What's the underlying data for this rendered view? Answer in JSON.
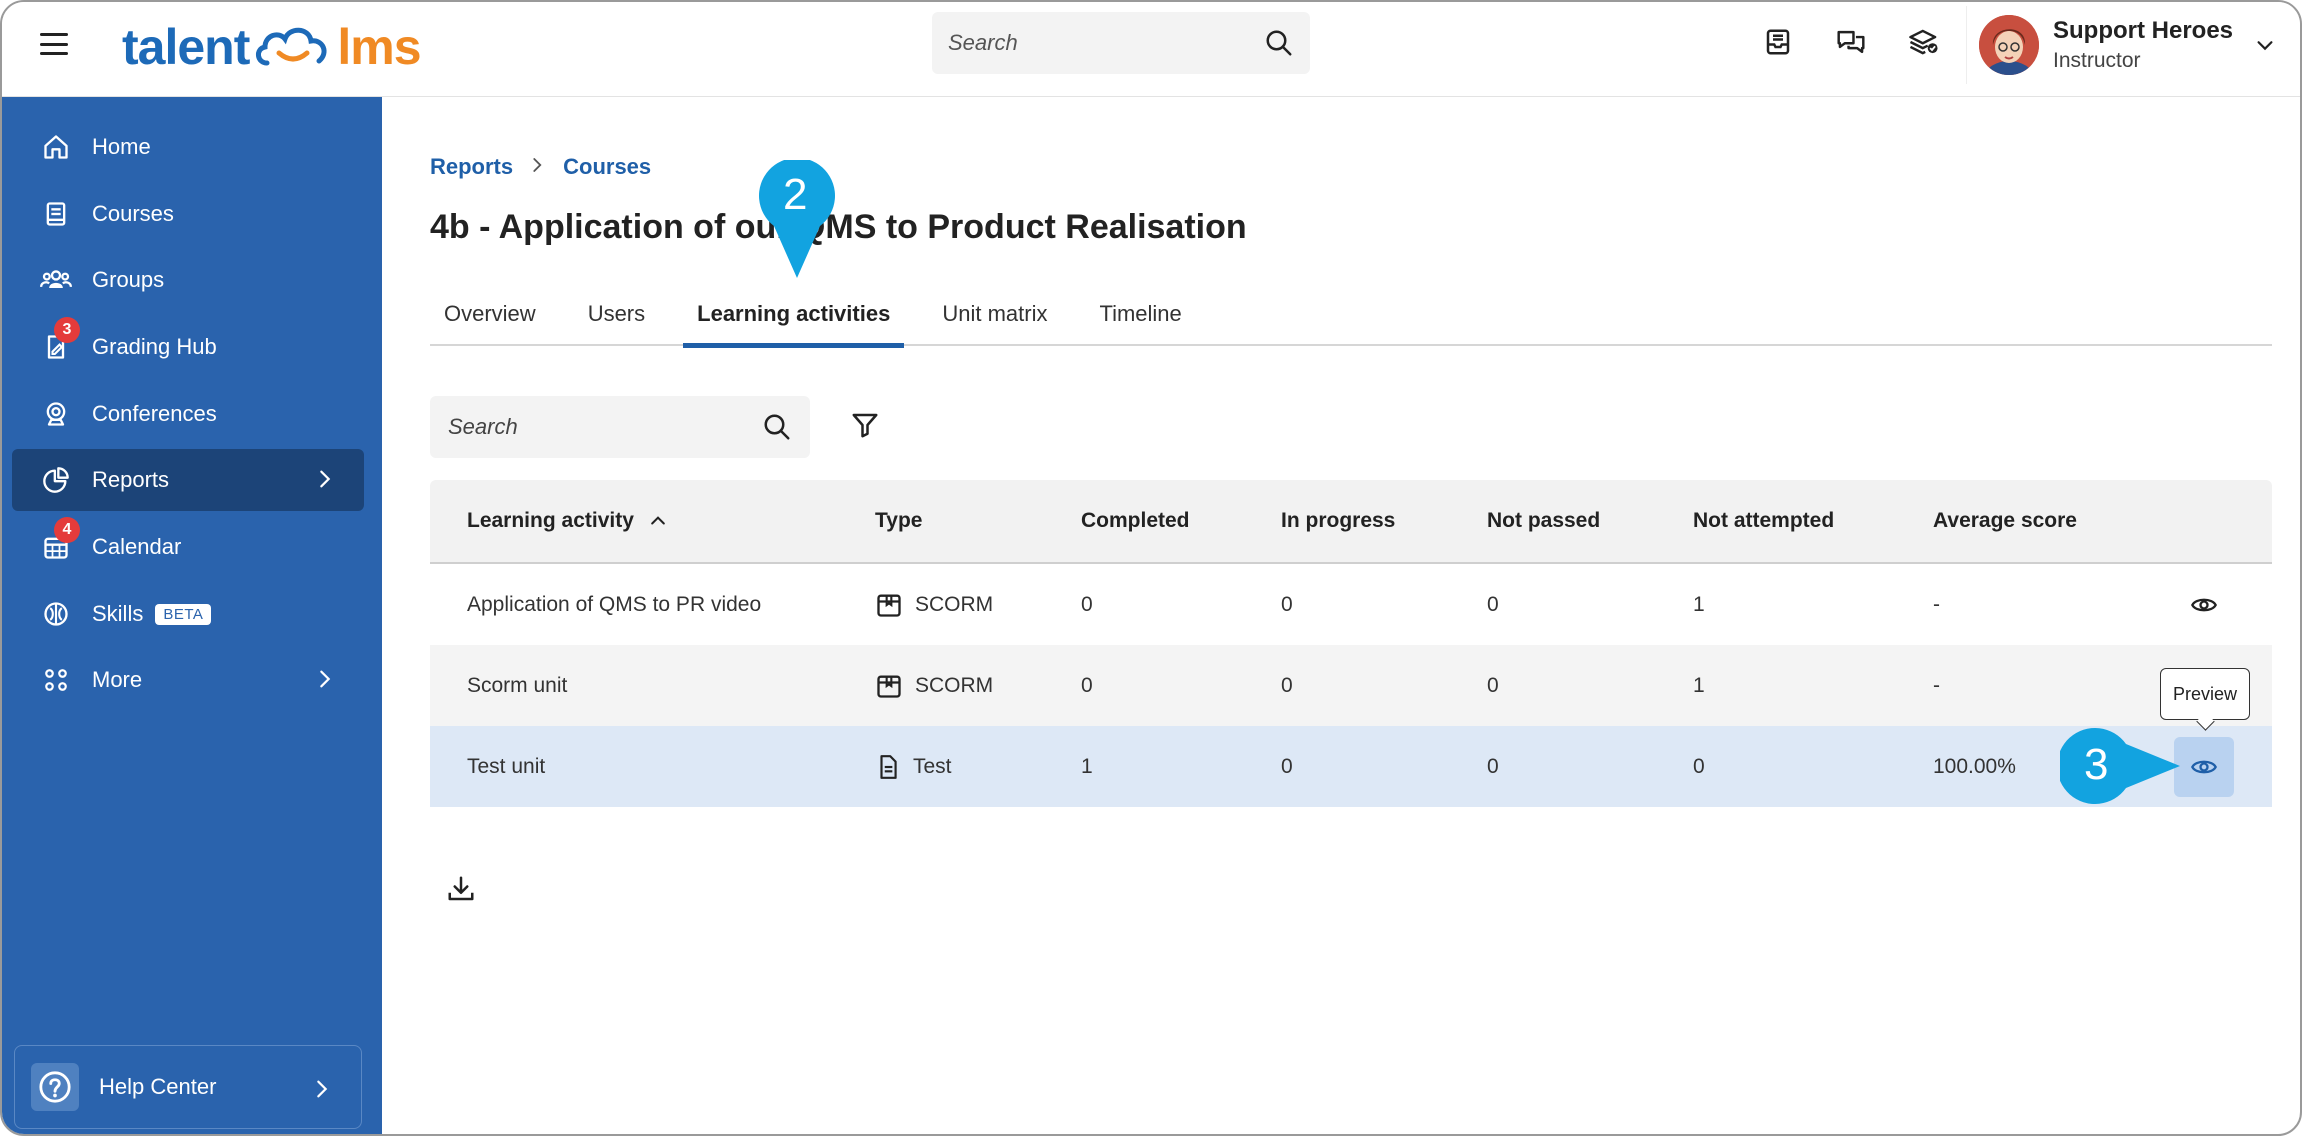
{
  "header": {
    "logo_left": "talent",
    "logo_right": "lms",
    "search_placeholder": "Search",
    "user_name": "Support Heroes",
    "user_role": "Instructor"
  },
  "sidebar": {
    "items": [
      {
        "label": "Home",
        "icon": "home-icon"
      },
      {
        "label": "Courses",
        "icon": "book-icon"
      },
      {
        "label": "Groups",
        "icon": "groups-icon"
      },
      {
        "label": "Grading Hub",
        "icon": "grading-icon",
        "badge": "3"
      },
      {
        "label": "Conferences",
        "icon": "webcam-icon"
      },
      {
        "label": "Reports",
        "icon": "pie-chart-icon",
        "active": true
      },
      {
        "label": "Calendar",
        "icon": "calendar-icon",
        "badge": "4"
      },
      {
        "label": "Skills",
        "icon": "brain-icon",
        "tag": "BETA"
      },
      {
        "label": "More",
        "icon": "grid-icon"
      }
    ],
    "help_label": "Help Center"
  },
  "breadcrumb": {
    "item1": "Reports",
    "item2": "Courses"
  },
  "page_title": "4b - Application of our QMS to Product Realisation",
  "tabs": [
    "Overview",
    "Users",
    "Learning activities",
    "Unit matrix",
    "Timeline"
  ],
  "active_tab": "Learning activities",
  "filters": {
    "search_placeholder": "Search"
  },
  "table": {
    "headers": [
      "Learning activity",
      "Type",
      "Completed",
      "In progress",
      "Not passed",
      "Not attempted",
      "Average score"
    ],
    "rows": [
      {
        "activity": "Application of QMS to PR video",
        "type": "SCORM",
        "type_icon": "package-icon",
        "completed": "0",
        "in_progress": "0",
        "not_passed": "0",
        "not_attempted": "1",
        "avg": "-"
      },
      {
        "activity": "Scorm unit",
        "type": "SCORM",
        "type_icon": "package-icon",
        "completed": "0",
        "in_progress": "0",
        "not_passed": "0",
        "not_attempted": "1",
        "avg": "-"
      },
      {
        "activity": "Test unit",
        "type": "Test",
        "type_icon": "document-icon",
        "completed": "1",
        "in_progress": "0",
        "not_passed": "0",
        "not_attempted": "0",
        "avg": "100.00%"
      }
    ]
  },
  "tooltip": "Preview",
  "callouts": {
    "step2": "2",
    "step3": "3"
  },
  "colors": {
    "sidebar": "#2a63ad",
    "sidebar_active": "#1c4478",
    "accent": "#1f5fa8",
    "callout": "#12a3e0",
    "badge": "#e43b3b"
  }
}
